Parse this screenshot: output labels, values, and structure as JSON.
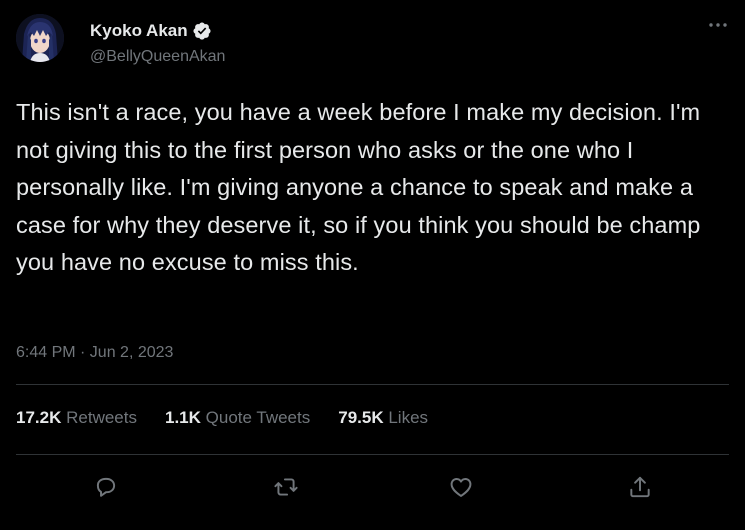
{
  "author": {
    "display_name": "Kyoko Akan",
    "handle": "@BellyQueenAkan",
    "verified": true
  },
  "tweet": {
    "text": "This isn't a race, you have a week before I make my decision. I'm not giving this to the first person who asks or the one who I personally like. I'm giving anyone a chance to speak and make a case for why they deserve it, so if you think you should be champ you have no excuse to miss this.",
    "timestamp": "6:44 PM · Jun 2, 2023"
  },
  "stats": {
    "retweets_count": "17.2K",
    "retweets_label": "Retweets",
    "quotes_count": "1.1K",
    "quotes_label": "Quote Tweets",
    "likes_count": "79.5K",
    "likes_label": "Likes"
  },
  "icons": {
    "more": "more-horizontal-icon",
    "verified": "verified-badge-icon",
    "reply": "reply-icon",
    "retweet": "retweet-icon",
    "like": "heart-icon",
    "share": "share-icon"
  },
  "colors": {
    "background": "#000000",
    "text": "#e7e9ea",
    "secondary": "#71767b",
    "divider": "#2f3336"
  }
}
